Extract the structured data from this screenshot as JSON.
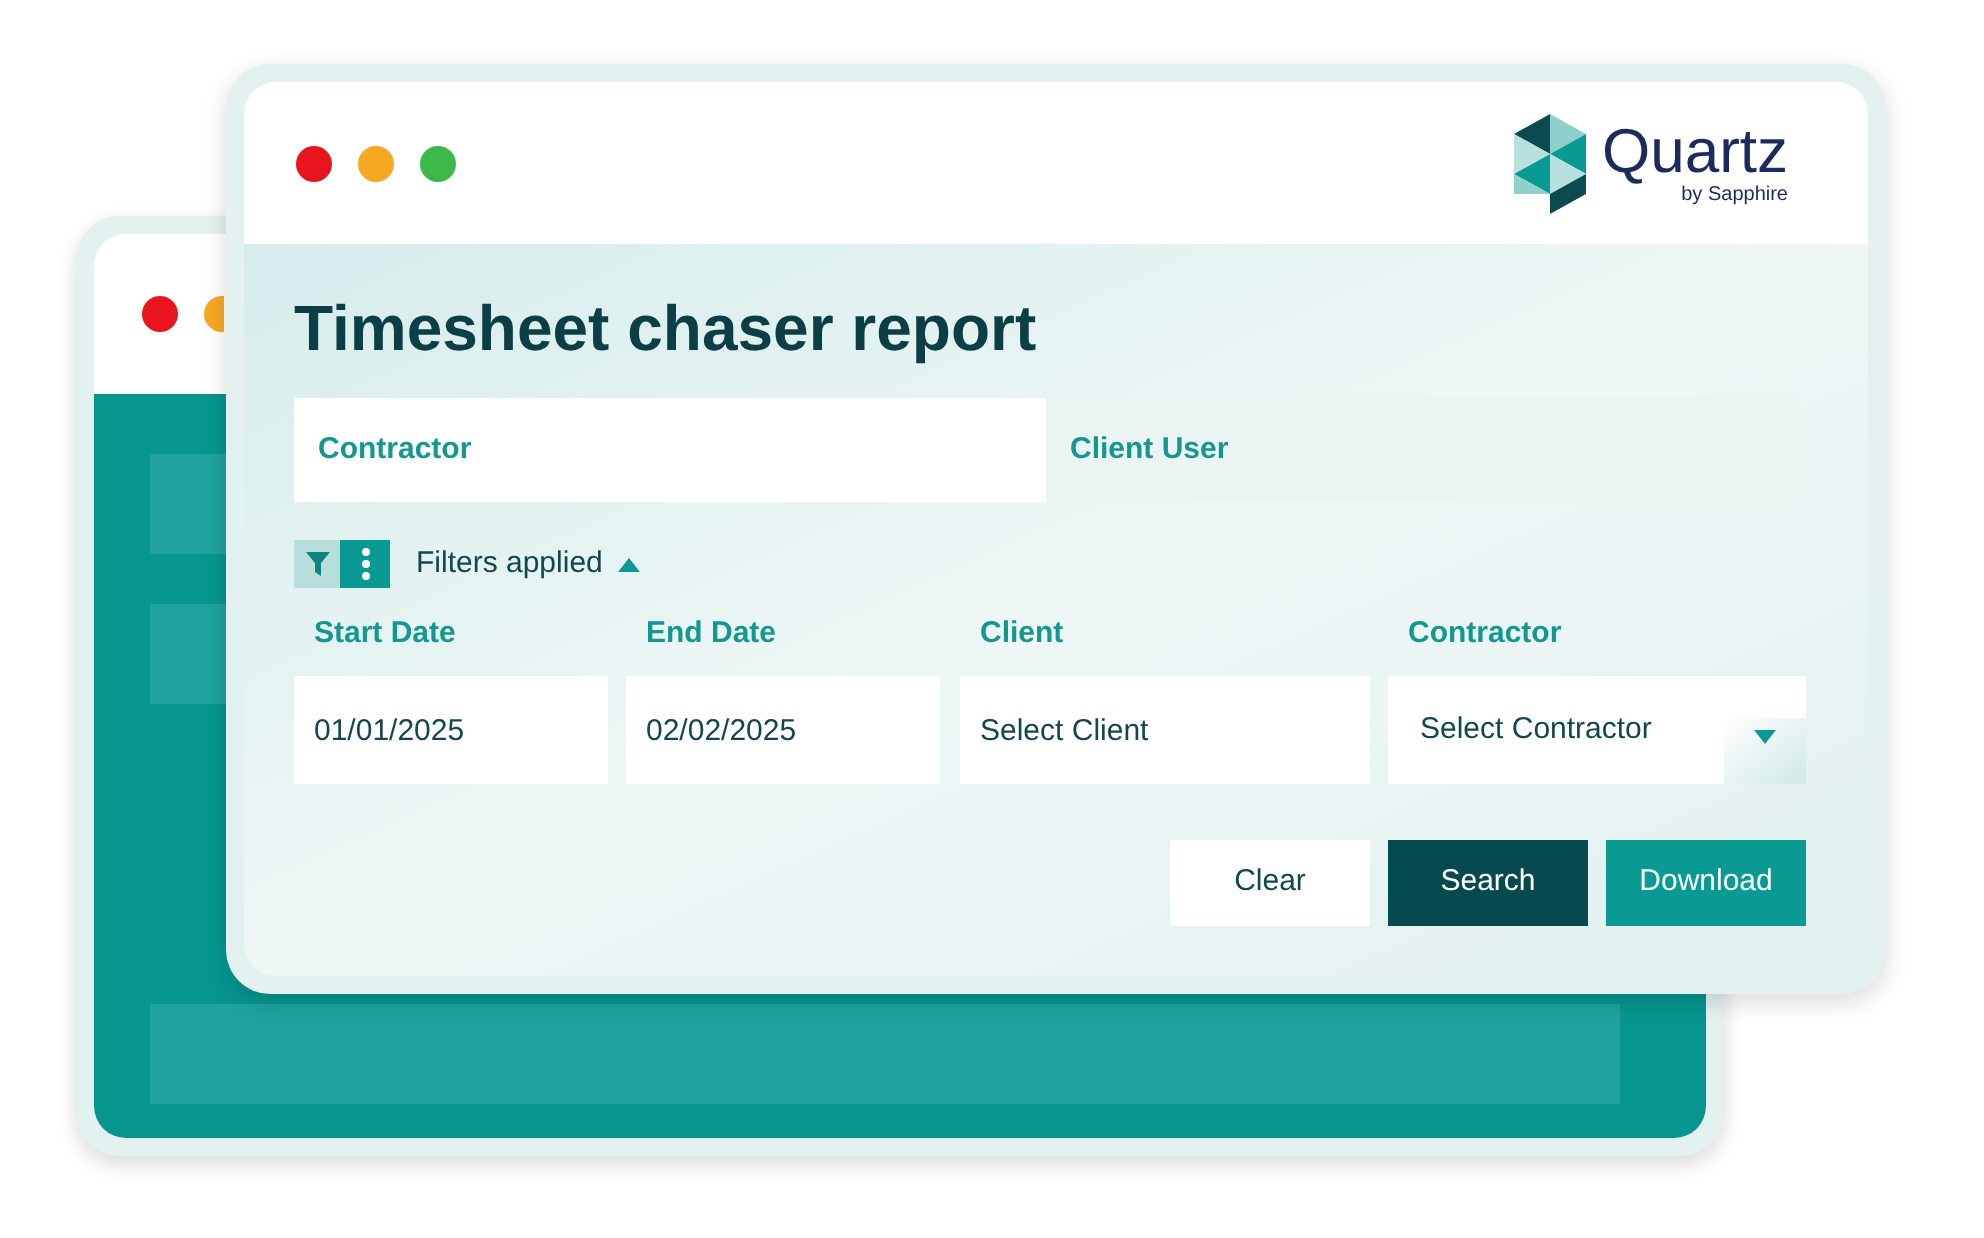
{
  "brand": {
    "name": "Quartz",
    "tagline": "by Sapphire"
  },
  "title": "Timesheet chaser report",
  "tabs": [
    {
      "label": "Contractor",
      "selected": true
    },
    {
      "label": "Client User",
      "selected": false
    }
  ],
  "filters": {
    "label": "Filters applied",
    "expanded": true
  },
  "fields": [
    {
      "label": "Start Date",
      "value": "01/01/2025",
      "kind": "text"
    },
    {
      "label": "End Date",
      "value": "02/02/2025",
      "kind": "text"
    },
    {
      "label": "Client",
      "value": "Select Client",
      "kind": "text"
    },
    {
      "label": "Contractor",
      "value": "Select Contractor",
      "kind": "dropdown"
    }
  ],
  "buttons": [
    {
      "label": "Clear",
      "kind": "plain"
    },
    {
      "label": "Search",
      "kind": "dark"
    },
    {
      "label": "Download",
      "kind": "primary"
    }
  ]
}
